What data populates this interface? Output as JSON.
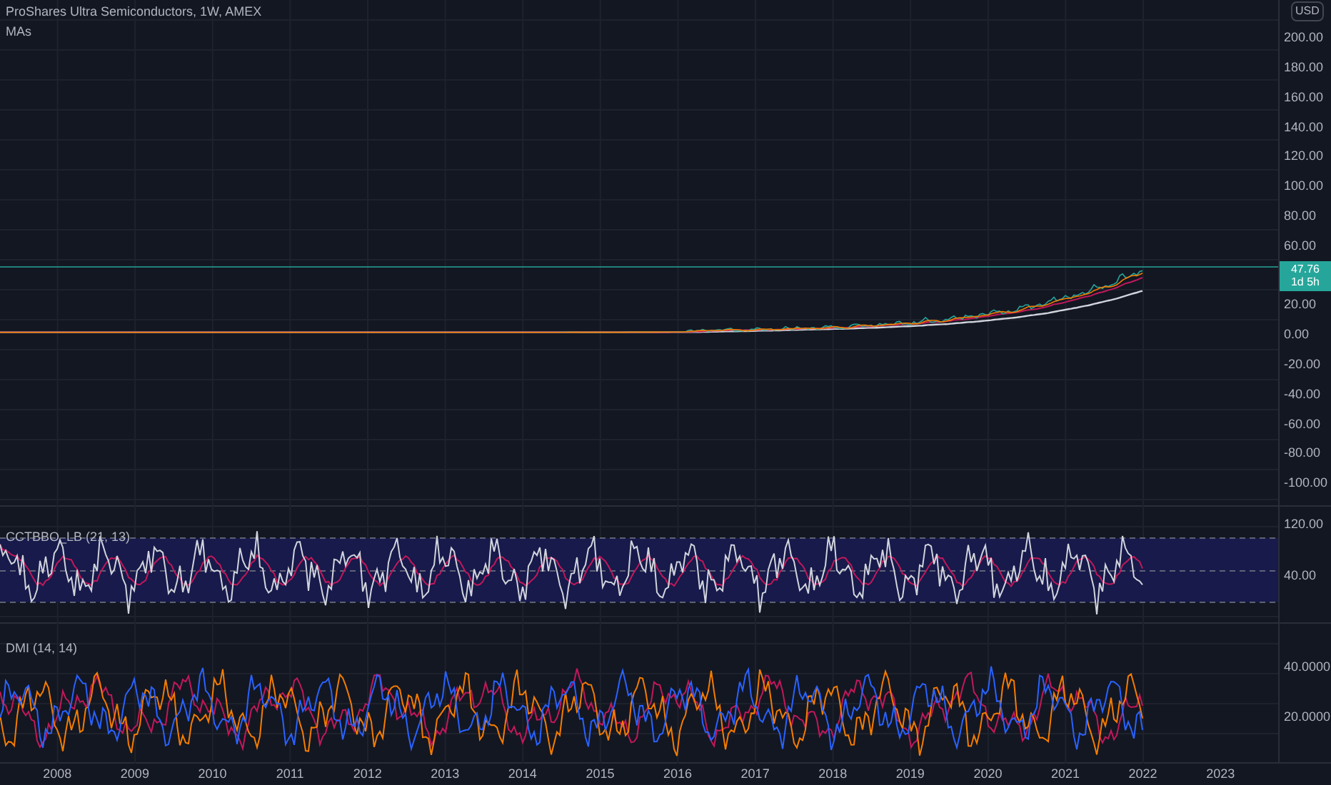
{
  "header": {
    "title": "ProShares Ultra Semiconductors, 1W, AMEX",
    "indicator": "MAs"
  },
  "currency": "USD",
  "price_axis": {
    "above_tag": [
      "200.00",
      "180.00",
      "160.00",
      "140.00",
      "120.00",
      "100.00",
      "80.00",
      "60.00"
    ],
    "below_tag": [
      "20.00",
      "0.00",
      "-20.00",
      "-40.00",
      "-60.00",
      "-80.00",
      "-100.00"
    ]
  },
  "price_tag": {
    "price": "47.76",
    "countdown": "1d 5h"
  },
  "oscillator": {
    "title": "CCTBBO_LB (21, 13)",
    "axis": [
      "120.00",
      "40.00"
    ]
  },
  "dmi": {
    "title": "DMI (14, 14)",
    "axis": [
      "40.0000",
      "20.0000"
    ]
  },
  "time_axis": [
    "2008",
    "2009",
    "2010",
    "2011",
    "2012",
    "2013",
    "2014",
    "2015",
    "2016",
    "2017",
    "2018",
    "2019",
    "2020",
    "2021",
    "2022",
    "2023"
  ]
}
